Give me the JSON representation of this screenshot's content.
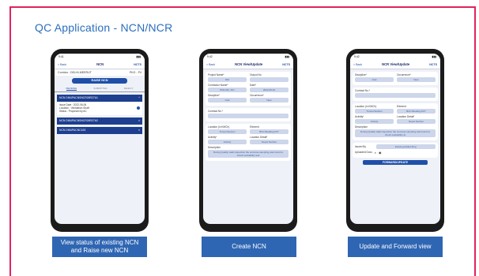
{
  "slide": {
    "title": "QC Application - NCN/NCR"
  },
  "phones": [
    {
      "caption_line1": "View status of existing NCN",
      "caption_line2": "and Raise new NCN",
      "time": "9:41",
      "back": "< Back",
      "screen_title": "NCN",
      "logo": "NCTS",
      "corridor": "Corridor : DELHI-MEERUT",
      "pkg": "PKG - P4",
      "raise_label": "RAISE NCN",
      "tabs": [
        "PENDING",
        "SUBMITTED",
        "REJECT"
      ],
      "cards": [
        {
          "id": "NCN DMUPACNSNCR26R27A1",
          "issue": "Issue Date : 2022-06-06",
          "location": "Location : Ventilation Shaft",
          "status": "Status : Proposed by AC"
        },
        {
          "id": "NCN DMUPACNSNCR26R27A2"
        },
        {
          "id": "NCN DMUPACNC163"
        }
      ]
    },
    {
      "caption": "Create NCN",
      "time": "9:42",
      "back": "< Back",
      "screen_title": "NCN View/Update",
      "logo": "NCTS",
      "fields": {
        "project_name_lbl": "Project Name*",
        "project_name": "DM",
        "output_lbl": "Output No.",
        "output": "",
        "contractor_lbl": "Contractor Name*",
        "contractor": "PNC-MC JVC",
        "date_lbl": "Date*",
        "date": "2022-06-16",
        "discipline_lbl": "Discipline*",
        "discipline": "Civil",
        "occurrence_lbl": "Occurrence*",
        "occurrence": "New",
        "contract_lbl": "Contract No.*",
        "contract": "",
        "location_lbl": "Location (in KMCh)",
        "location": "Tunnel Section",
        "element_lbl": "Element",
        "element": "BCC Bedding FFT",
        "activity_lbl": "Activity*",
        "activity": "Activity",
        "loc_detail_lbl": "Location Detail*",
        "loc_detail": "Depot Section",
        "description_lbl": "Description",
        "description": "During Quality walk inspection the concrete sampling was found to check workability and"
      }
    },
    {
      "caption": "Update and Forward view",
      "time": "9:42",
      "back": "< Back",
      "screen_title": "NCR View/Update",
      "logo": "NCTS",
      "fields": {
        "discipline_lbl": "Discipline*",
        "discipline": "Civil",
        "occurrence_lbl": "Occurrence*",
        "occurrence": "New",
        "contract_lbl": "Contract No.*",
        "contract": "",
        "location_lbl": "Location (in KMCh)",
        "location": "Tunnel Section",
        "element_lbl": "Element",
        "element": "BCC Bedding FFT",
        "activity_lbl": "Activity*",
        "activity": "Activity",
        "loc_detail_lbl": "Location Detail*",
        "loc_detail": "Depot Section",
        "description_lbl": "Description",
        "description": "During Quality walk inspection the concrete sampling was found to check workability at",
        "issued_by_lbl": "Issued By",
        "issued_by": "Existing Added Mng",
        "uploaded_lbl": "Uploaded Docs",
        "forward_label": "FORWARD/UPDATE"
      }
    }
  ]
}
